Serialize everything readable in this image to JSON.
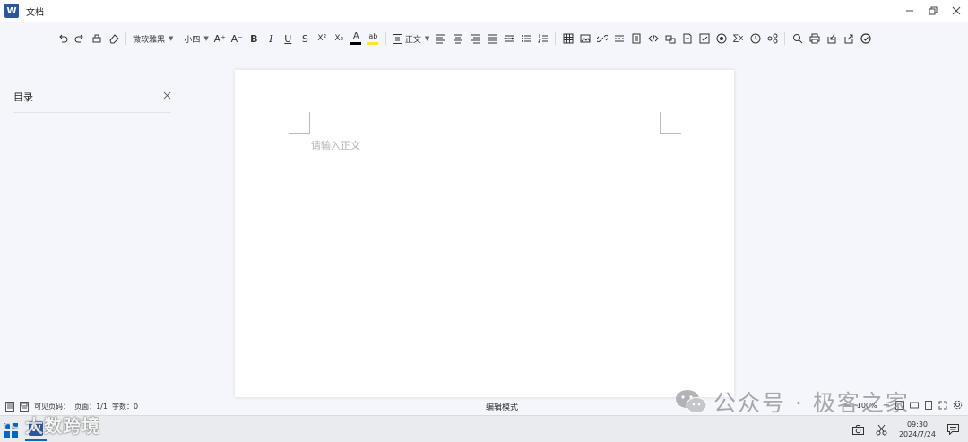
{
  "window": {
    "title": "文档",
    "app_icon_letter": "W"
  },
  "toolbar": {
    "font_family": "微软雅黑",
    "font_size": "小四",
    "paragraph_style": "正文",
    "font_color": "#000000",
    "highlight_color": "#f5e72a",
    "grow_font_glyph": "A⁺",
    "shrink_font_glyph": "A⁻",
    "bold_glyph": "B",
    "italic_glyph": "I",
    "underline_glyph": "U",
    "strike_glyph": "S",
    "superscript_glyph": "X²",
    "subscript_glyph": "X₂",
    "font_color_glyph": "A",
    "highlight_glyph": "ab",
    "formula_glyph": "∑x"
  },
  "toc": {
    "title": "目录"
  },
  "document": {
    "placeholder": "请输入正文"
  },
  "statusbar": {
    "page_info": "可见页码：  页面：1/1  字数：0",
    "mode": "编辑模式",
    "zoom": "100%"
  },
  "taskbar": {
    "time": "09:30",
    "date": "2024/7/24"
  },
  "watermarks": {
    "right": "公众号 · 极客之家",
    "left": "大数跨境"
  }
}
